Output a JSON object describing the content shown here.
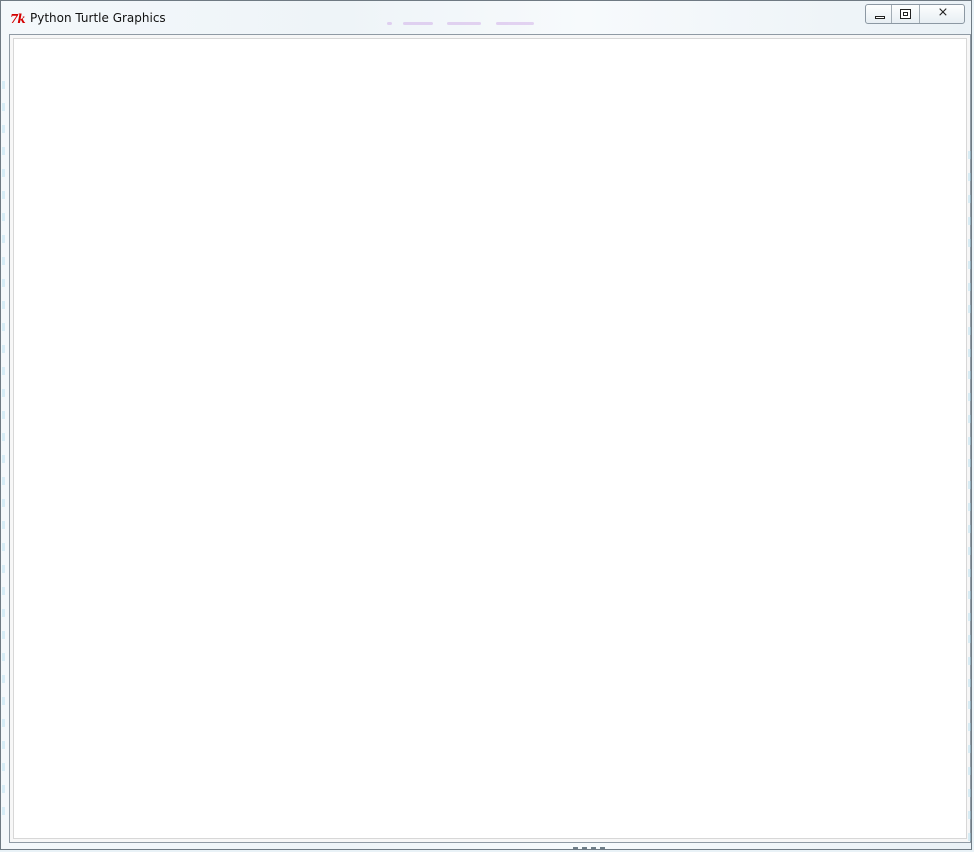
{
  "window": {
    "title": "Python Turtle Graphics",
    "icon": "tk-icon"
  },
  "title_bar": {
    "buttons": [
      {
        "name": "minimize-button",
        "icon": "minimize-icon"
      },
      {
        "name": "maximize-button",
        "icon": "maximize-icon"
      },
      {
        "name": "close-button",
        "icon": "close-icon",
        "glyph": "⨯"
      }
    ]
  },
  "canvas": {
    "background": "#ffffff"
  },
  "colors": {
    "tk_icon": "#d40000",
    "window_border": "#6f7a83"
  }
}
